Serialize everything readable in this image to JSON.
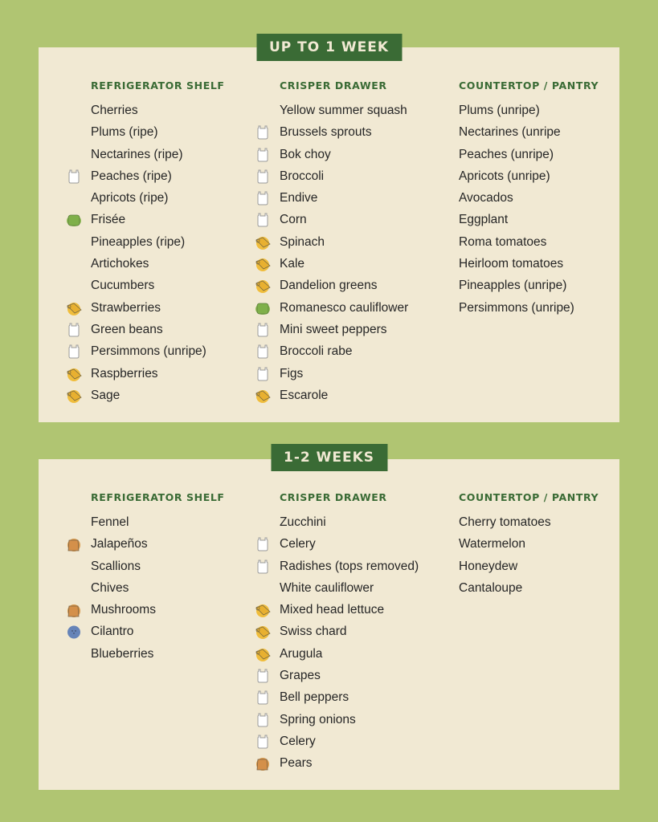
{
  "icon_legend": {
    "plastic-bag": "white produce bag",
    "paper-towel": "yellow paper towel roll",
    "container": "green container",
    "paper-bag": "orange paper bag",
    "blue-bag": "blue round bag"
  },
  "sections": [
    {
      "title": "UP TO 1 WEEK",
      "columns": [
        {
          "heading": "REFRIGERATOR SHELF",
          "items": [
            {
              "label": "Cherries",
              "icon": ""
            },
            {
              "label": "Plums (ripe)",
              "icon": ""
            },
            {
              "label": "Nectarines (ripe)",
              "icon": ""
            },
            {
              "label": "Peaches (ripe)",
              "icon": "plastic-bag"
            },
            {
              "label": "Apricots (ripe)",
              "icon": ""
            },
            {
              "label": "Frisée",
              "icon": "container"
            },
            {
              "label": "Pineapples (ripe)",
              "icon": ""
            },
            {
              "label": "Artichokes",
              "icon": ""
            },
            {
              "label": "Cucumbers",
              "icon": ""
            },
            {
              "label": "Strawberries",
              "icon": "paper-towel"
            },
            {
              "label": "Green beans",
              "icon": "plastic-bag"
            },
            {
              "label": "Persimmons (unripe)",
              "icon": "plastic-bag"
            },
            {
              "label": "Raspberries",
              "icon": "paper-towel"
            },
            {
              "label": "Sage",
              "icon": "paper-towel"
            }
          ]
        },
        {
          "heading": "CRISPER DRAWER",
          "items": [
            {
              "label": "Yellow summer squash",
              "icon": ""
            },
            {
              "label": "Brussels sprouts",
              "icon": "plastic-bag"
            },
            {
              "label": "Bok choy",
              "icon": "plastic-bag"
            },
            {
              "label": "Broccoli",
              "icon": "plastic-bag"
            },
            {
              "label": "Endive",
              "icon": "plastic-bag"
            },
            {
              "label": "Corn",
              "icon": "plastic-bag"
            },
            {
              "label": "Spinach",
              "icon": "paper-towel"
            },
            {
              "label": "Kale",
              "icon": "paper-towel"
            },
            {
              "label": "Dandelion greens",
              "icon": "paper-towel"
            },
            {
              "label": "Romanesco cauliflower",
              "icon": "container"
            },
            {
              "label": "Mini sweet peppers",
              "icon": "plastic-bag"
            },
            {
              "label": "Broccoli rabe",
              "icon": "plastic-bag"
            },
            {
              "label": "Figs",
              "icon": "plastic-bag"
            },
            {
              "label": "Escarole",
              "icon": "paper-towel"
            }
          ]
        },
        {
          "heading": "COUNTERTOP / PANTRY",
          "items": [
            {
              "label": "Plums (unripe)",
              "icon": ""
            },
            {
              "label": "Nectarines (unripe",
              "icon": ""
            },
            {
              "label": "Peaches (unripe)",
              "icon": ""
            },
            {
              "label": "Apricots (unripe)",
              "icon": ""
            },
            {
              "label": "Avocados",
              "icon": ""
            },
            {
              "label": "Eggplant",
              "icon": ""
            },
            {
              "label": "Roma tomatoes",
              "icon": ""
            },
            {
              "label": "Heirloom tomatoes",
              "icon": ""
            },
            {
              "label": "Pineapples (unripe)",
              "icon": ""
            },
            {
              "label": "Persimmons (unripe)",
              "icon": ""
            }
          ]
        }
      ]
    },
    {
      "title": "1-2 WEEKS",
      "columns": [
        {
          "heading": "REFRIGERATOR SHELF",
          "items": [
            {
              "label": "Fennel",
              "icon": ""
            },
            {
              "label": "Jalapeños",
              "icon": "paper-bag"
            },
            {
              "label": "Scallions",
              "icon": ""
            },
            {
              "label": "Chives",
              "icon": ""
            },
            {
              "label": "Mushrooms",
              "icon": "paper-bag"
            },
            {
              "label": "Cilantro",
              "icon": "blue-bag"
            },
            {
              "label": "Blueberries",
              "icon": ""
            }
          ]
        },
        {
          "heading": "CRISPER DRAWER",
          "items": [
            {
              "label": "Zucchini",
              "icon": ""
            },
            {
              "label": "Celery",
              "icon": "plastic-bag"
            },
            {
              "label": "Radishes (tops removed)",
              "icon": "plastic-bag"
            },
            {
              "label": "White cauliflower",
              "icon": ""
            },
            {
              "label": "Mixed head lettuce",
              "icon": "paper-towel"
            },
            {
              "label": "Swiss chard",
              "icon": "paper-towel"
            },
            {
              "label": "Arugula",
              "icon": "paper-towel"
            },
            {
              "label": "Grapes",
              "icon": "plastic-bag"
            },
            {
              "label": "Bell peppers",
              "icon": "plastic-bag"
            },
            {
              "label": "Spring onions",
              "icon": "plastic-bag"
            },
            {
              "label": "Celery",
              "icon": "plastic-bag"
            },
            {
              "label": "Pears",
              "icon": "paper-bag"
            }
          ]
        },
        {
          "heading": "COUNTERTOP / PANTRY",
          "items": [
            {
              "label": "Cherry tomatoes",
              "icon": ""
            },
            {
              "label": "Watermelon",
              "icon": ""
            },
            {
              "label": "Honeydew",
              "icon": ""
            },
            {
              "label": "Cantaloupe",
              "icon": ""
            }
          ]
        }
      ]
    }
  ]
}
